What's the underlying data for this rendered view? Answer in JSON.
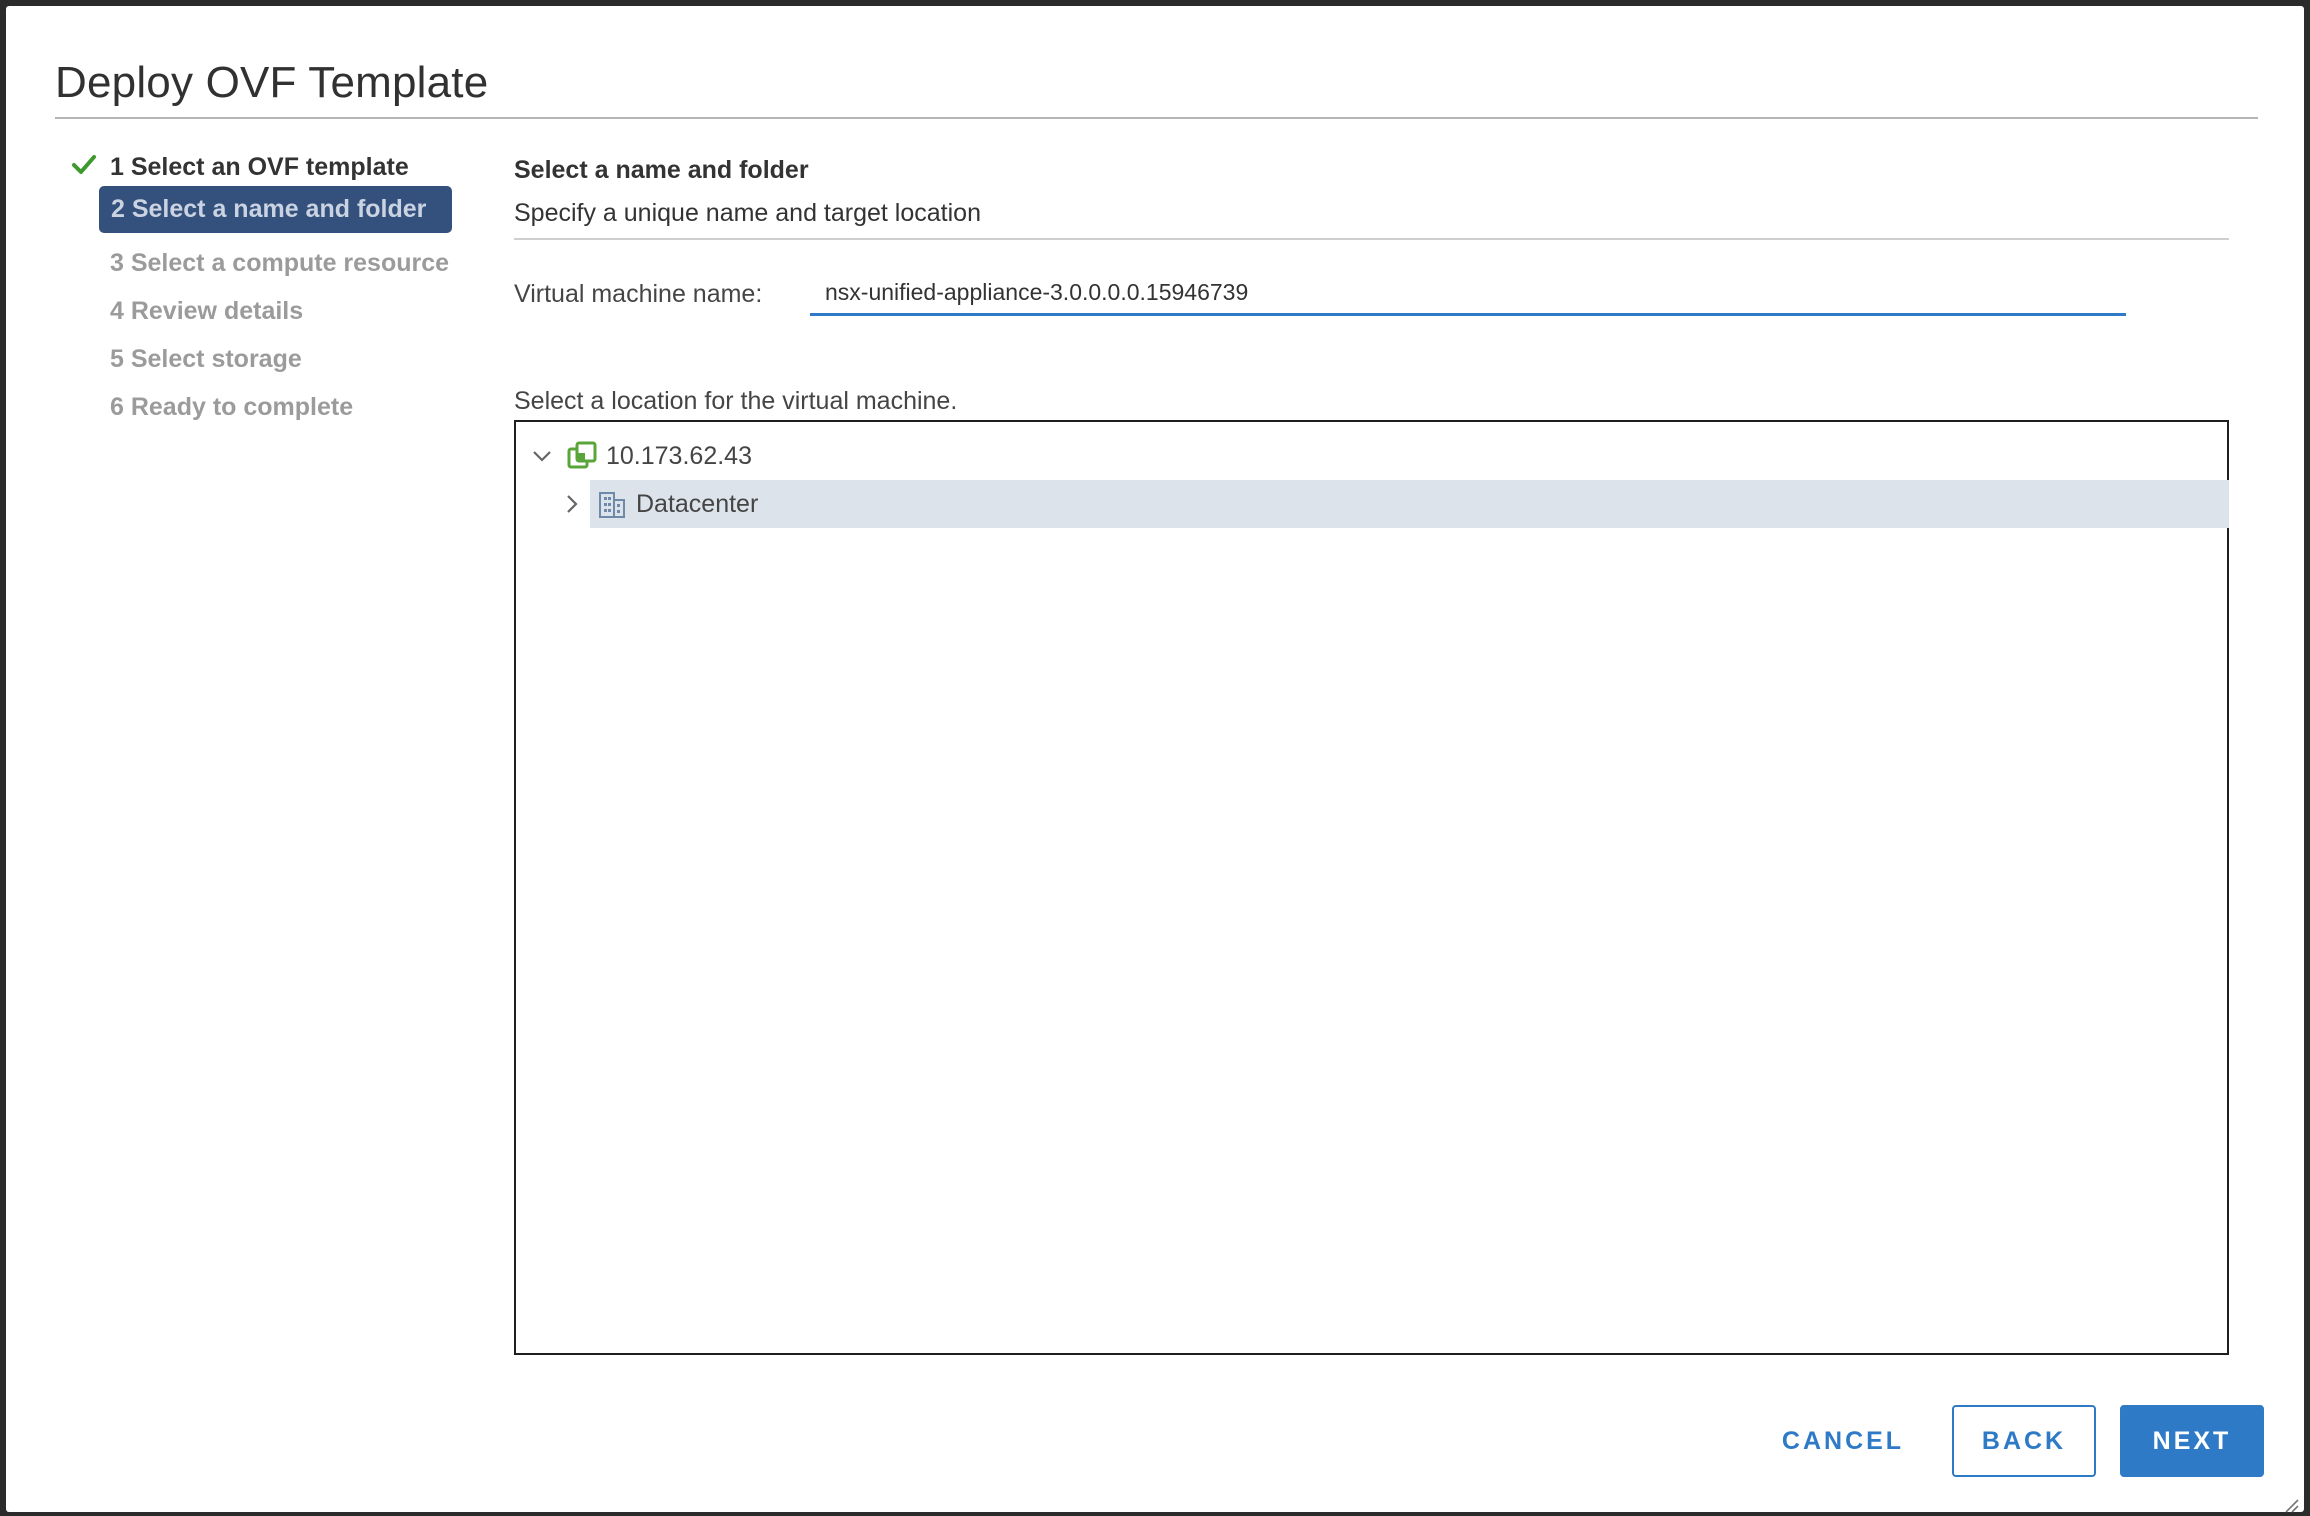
{
  "dialog": {
    "title": "Deploy OVF Template"
  },
  "steps": [
    {
      "label": "1 Select an OVF template",
      "state": "done"
    },
    {
      "label": "2 Select a name and folder",
      "state": "active"
    },
    {
      "label": "3 Select a compute resource",
      "state": "pending"
    },
    {
      "label": "4 Review details",
      "state": "pending"
    },
    {
      "label": "5 Select storage",
      "state": "pending"
    },
    {
      "label": "6 Ready to complete",
      "state": "pending"
    }
  ],
  "main": {
    "section_title": "Select a name and folder",
    "section_subtitle": "Specify a unique name and target location",
    "vm_name_label": "Virtual machine name:",
    "vm_name_value": "nsx-unified-appliance-3.0.0.0.0.15946739",
    "location_label": "Select a location for the virtual machine."
  },
  "tree": {
    "root": {
      "label": "10.173.62.43",
      "icon": "vcenter-icon",
      "expanded": true
    },
    "children": [
      {
        "label": "Datacenter",
        "icon": "datacenter-icon",
        "expanded": false,
        "selected": true
      }
    ]
  },
  "footer": {
    "cancel_label": "CANCEL",
    "back_label": "BACK",
    "next_label": "NEXT"
  },
  "colors": {
    "accent": "#2f7ac6",
    "active_step_bg": "#34507c",
    "check": "#3c9a2c",
    "selected_row": "#dce3ea"
  }
}
